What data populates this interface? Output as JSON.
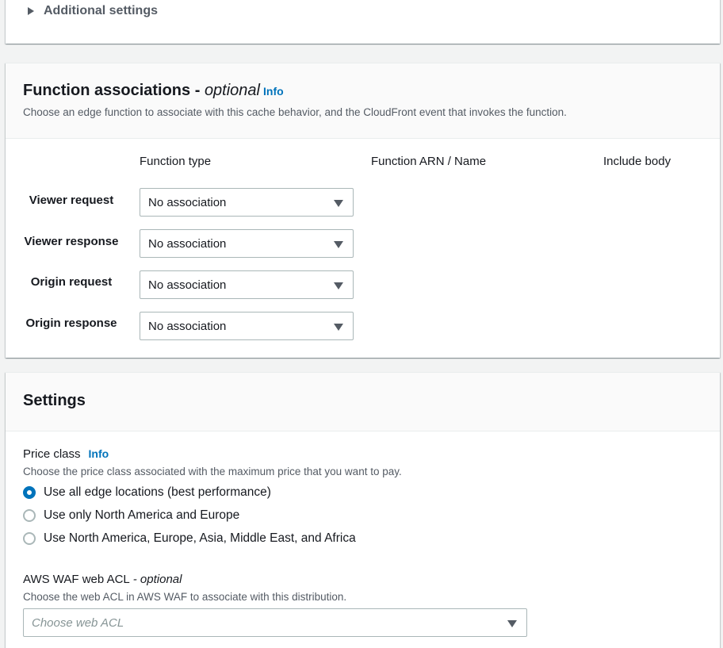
{
  "additional": {
    "label": "Additional settings"
  },
  "functions": {
    "title": "Function associations",
    "title_sep": " - ",
    "title_optional": "optional",
    "info": "Info",
    "description": "Choose an edge function to associate with this cache behavior, and the CloudFront event that invokes the function.",
    "columns": [
      "Function type",
      "Function ARN / Name",
      "Include body"
    ],
    "rows": [
      {
        "label": "Viewer request",
        "value": "No association"
      },
      {
        "label": "Viewer response",
        "value": "No association"
      },
      {
        "label": "Origin request",
        "value": "No association"
      },
      {
        "label": "Origin response",
        "value": "No association"
      }
    ]
  },
  "settings": {
    "title": "Settings",
    "price_class": {
      "label": "Price class",
      "info": "Info",
      "description": "Choose the price class associated with the maximum price that you want to pay.",
      "options": [
        {
          "label": "Use all edge locations (best performance)",
          "checked": true
        },
        {
          "label": "Use only North America and Europe",
          "checked": false
        },
        {
          "label": "Use North America, Europe, Asia, Middle East, and Africa",
          "checked": false
        }
      ]
    },
    "waf": {
      "label": "AWS WAF web ACL",
      "label_optional": "- optional",
      "description": "Choose the web ACL in AWS WAF to associate with this distribution.",
      "placeholder": "Choose web ACL"
    }
  },
  "colors": {
    "accent": "#0073bb",
    "text": "#16191f",
    "muted": "#545b64",
    "border": "#aab7b8"
  }
}
